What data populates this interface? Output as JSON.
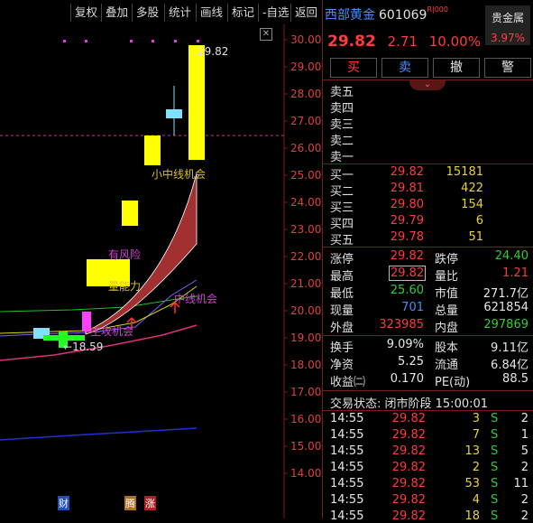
{
  "toolbar": {
    "items": [
      "复权",
      "叠加",
      "多股",
      "统计",
      "画线",
      "标记",
      "-自选",
      "返回"
    ]
  },
  "chart": {
    "y_ticks": [
      "30.00",
      "29.00",
      "28.00",
      "27.00",
      "26.00",
      "25.00",
      "24.00",
      "23.00",
      "22.00",
      "21.00",
      "20.00",
      "19.00",
      "18.00",
      "17.00",
      "16.00",
      "15.00",
      "14.00"
    ],
    "high_label": "29.82",
    "low_label": "18.59",
    "annotations": [
      "小中线机会",
      "有风险",
      "量能力",
      "中线机会",
      "主攻机会"
    ],
    "bottom_markers": [
      "财",
      "腾",
      "涨"
    ],
    "colors": {
      "up_candle": "#ffff00",
      "down_candle": "#00ff00",
      "ribbon": "#a33030",
      "ref_line": "#d03090",
      "blue_line": "#2030d0"
    }
  },
  "stock": {
    "name": "西部黄金",
    "code": "601069",
    "flag": "R|000",
    "price": "29.82",
    "change": "2.71",
    "change_pct": "10.00%",
    "sector": "贵金属",
    "sector_pct": "3.97%"
  },
  "buttons": {
    "buy": "买",
    "sell": "卖",
    "cancel": "撤",
    "alert": "警"
  },
  "asks": [
    {
      "label": "卖五",
      "price": "",
      "vol": ""
    },
    {
      "label": "卖四",
      "price": "",
      "vol": ""
    },
    {
      "label": "卖三",
      "price": "",
      "vol": ""
    },
    {
      "label": "卖二",
      "price": "",
      "vol": ""
    },
    {
      "label": "卖一",
      "price": "",
      "vol": ""
    }
  ],
  "bids": [
    {
      "label": "买一",
      "price": "29.82",
      "vol": "15181"
    },
    {
      "label": "买二",
      "price": "29.81",
      "vol": "422"
    },
    {
      "label": "买三",
      "price": "29.80",
      "vol": "154"
    },
    {
      "label": "买四",
      "price": "29.79",
      "vol": "6"
    },
    {
      "label": "买五",
      "price": "29.78",
      "vol": "51"
    }
  ],
  "stats": {
    "zhangting_l": "涨停",
    "zhangting": "29.82",
    "dieting_l": "跌停",
    "dieting": "24.40",
    "zuigao_l": "最高",
    "zuigao": "29.82",
    "liangbi_l": "量比",
    "liangbi": "1.21",
    "zuidi_l": "最低",
    "zuidi": "25.60",
    "shizhi_l": "市值",
    "shizhi": "271.7亿",
    "xianliang_l": "现量",
    "xianliang": "701",
    "zongliang_l": "总量",
    "zongliang": "621854",
    "waipan_l": "外盘",
    "waipan": "323985",
    "neipan_l": "内盘",
    "neipan": "297869",
    "huanshou_l": "换手",
    "huanshou": "9.09%",
    "guben_l": "股本",
    "guben": "9.11亿",
    "jingzi_l": "净资",
    "jingzi": "5.25",
    "liutong_l": "流通",
    "liutong": "6.84亿",
    "shouyi_l": "收益㈡",
    "shouyi": "0.170",
    "pe_l": "PE(动)",
    "pe": "88.5"
  },
  "status_line": "交易状态: 闭市阶段 15:00:01",
  "ticks": [
    {
      "time": "14:55",
      "price": "29.82",
      "vol": "3",
      "side": "S",
      "n": "2"
    },
    {
      "time": "14:55",
      "price": "29.82",
      "vol": "7",
      "side": "S",
      "n": "1"
    },
    {
      "time": "14:55",
      "price": "29.82",
      "vol": "13",
      "side": "S",
      "n": "5"
    },
    {
      "time": "14:55",
      "price": "29.82",
      "vol": "2",
      "side": "S",
      "n": "2"
    },
    {
      "time": "14:55",
      "price": "29.82",
      "vol": "53",
      "side": "S",
      "n": "11"
    },
    {
      "time": "14:55",
      "price": "29.82",
      "vol": "4",
      "side": "S",
      "n": "2"
    },
    {
      "time": "14:55",
      "price": "29.82",
      "vol": "18",
      "side": "S",
      "n": "2"
    }
  ]
}
